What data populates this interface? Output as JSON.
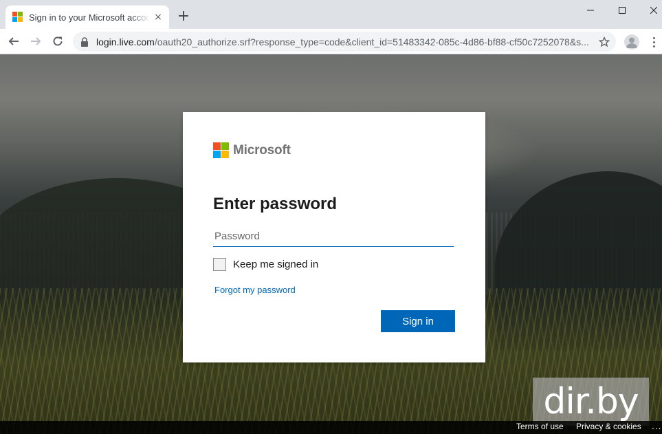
{
  "browser": {
    "tab_title": "Sign in to your Microsoft account",
    "tab_close": "×",
    "new_tab": "+",
    "url_host": "login.live.com",
    "url_path": "/oauth20_authorize.srf?response_type=code&client_id=51483342-085c-4d86-bf88-cf50c7252078&s...",
    "icons": [
      "microsoft-favicon",
      "back-arrow-icon",
      "forward-arrow-icon",
      "reload-icon",
      "lock-icon",
      "star-icon",
      "avatar-icon",
      "kebab-menu-icon",
      "minimize-icon",
      "maximize-icon",
      "close-window-icon"
    ]
  },
  "colors": {
    "ms_red": "#f25022",
    "ms_green": "#7fba00",
    "ms_blue": "#00a4ef",
    "ms_yellow": "#ffb900",
    "accent": "#0067b8"
  },
  "card": {
    "brand": "Microsoft",
    "heading": "Enter password",
    "password_placeholder": "Password",
    "password_value": "",
    "keep_signed_in": "Keep me signed in",
    "keep_signed_in_checked": false,
    "forgot": "Forgot my password",
    "sign_in": "Sign in"
  },
  "footer": {
    "terms": "Terms of use",
    "privacy": "Privacy & cookies",
    "more": "..."
  },
  "watermark": "dir.by"
}
